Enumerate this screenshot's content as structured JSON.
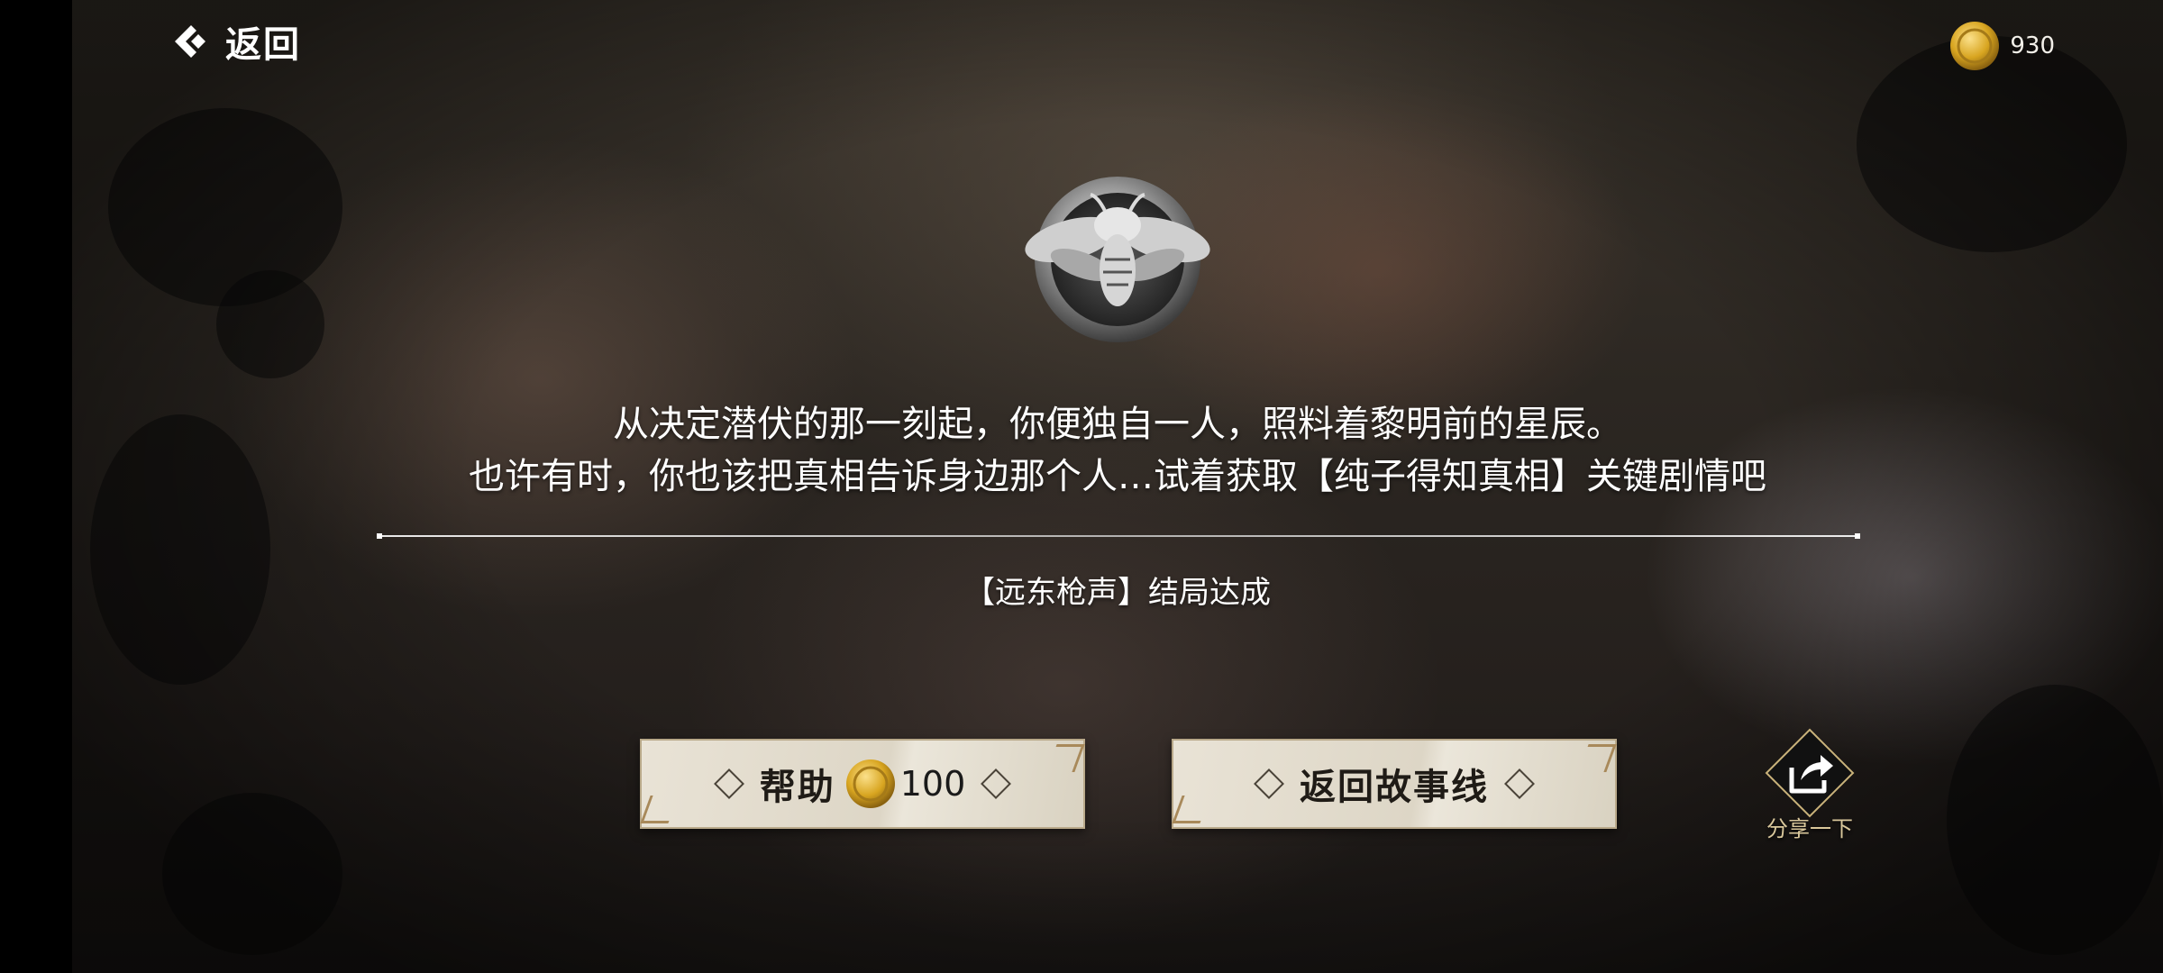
{
  "header": {
    "back_label": "返回",
    "coin_count": "930"
  },
  "badge": {
    "icon": "bee-emblem-icon"
  },
  "message": {
    "line1": "从决定潜伏的那一刻起，你便独自一人，照料着黎明前的星辰。",
    "line2": "也许有时，你也该把真相告诉身边那个人…试着获取【纯子得知真相】关键剧情吧"
  },
  "ending_text": "【远东枪声】结局达成",
  "buttons": {
    "help_label": "帮助",
    "help_cost": "100",
    "story_label": "返回故事线"
  },
  "share": {
    "label": "分享一下"
  },
  "colors": {
    "button_bg": "#e9e3d6",
    "button_border": "#b9a98a",
    "share_label": "#d9c79b",
    "coin_gold": "#d8a520"
  }
}
